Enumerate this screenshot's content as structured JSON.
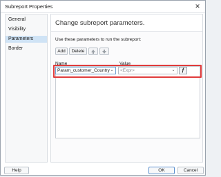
{
  "window": {
    "title": "Subreport Properties",
    "close_glyph": "✕"
  },
  "nav": {
    "items": [
      {
        "label": "General",
        "selected": false
      },
      {
        "label": "Visibility",
        "selected": false
      },
      {
        "label": "Parameters",
        "selected": true
      },
      {
        "label": "Border",
        "selected": false
      }
    ]
  },
  "main": {
    "header": "Change subreport parameters.",
    "intro": "Use these parameters to run the subreport:",
    "toolbar": {
      "add_label": "Add",
      "delete_label": "Delete",
      "move_up_icon": "arrow-up-icon",
      "move_down_icon": "arrow-down-icon"
    },
    "columns": {
      "name": "Name",
      "value": "Value"
    },
    "rows": [
      {
        "name": "Param_customer_Country",
        "value_placeholder": "<Expr>"
      }
    ],
    "expression_button_icon": "fx-icon",
    "highlight_color": "#e03b3b"
  },
  "footer": {
    "help_label": "Help",
    "ok_label": "OK",
    "cancel_label": "Cancel"
  }
}
